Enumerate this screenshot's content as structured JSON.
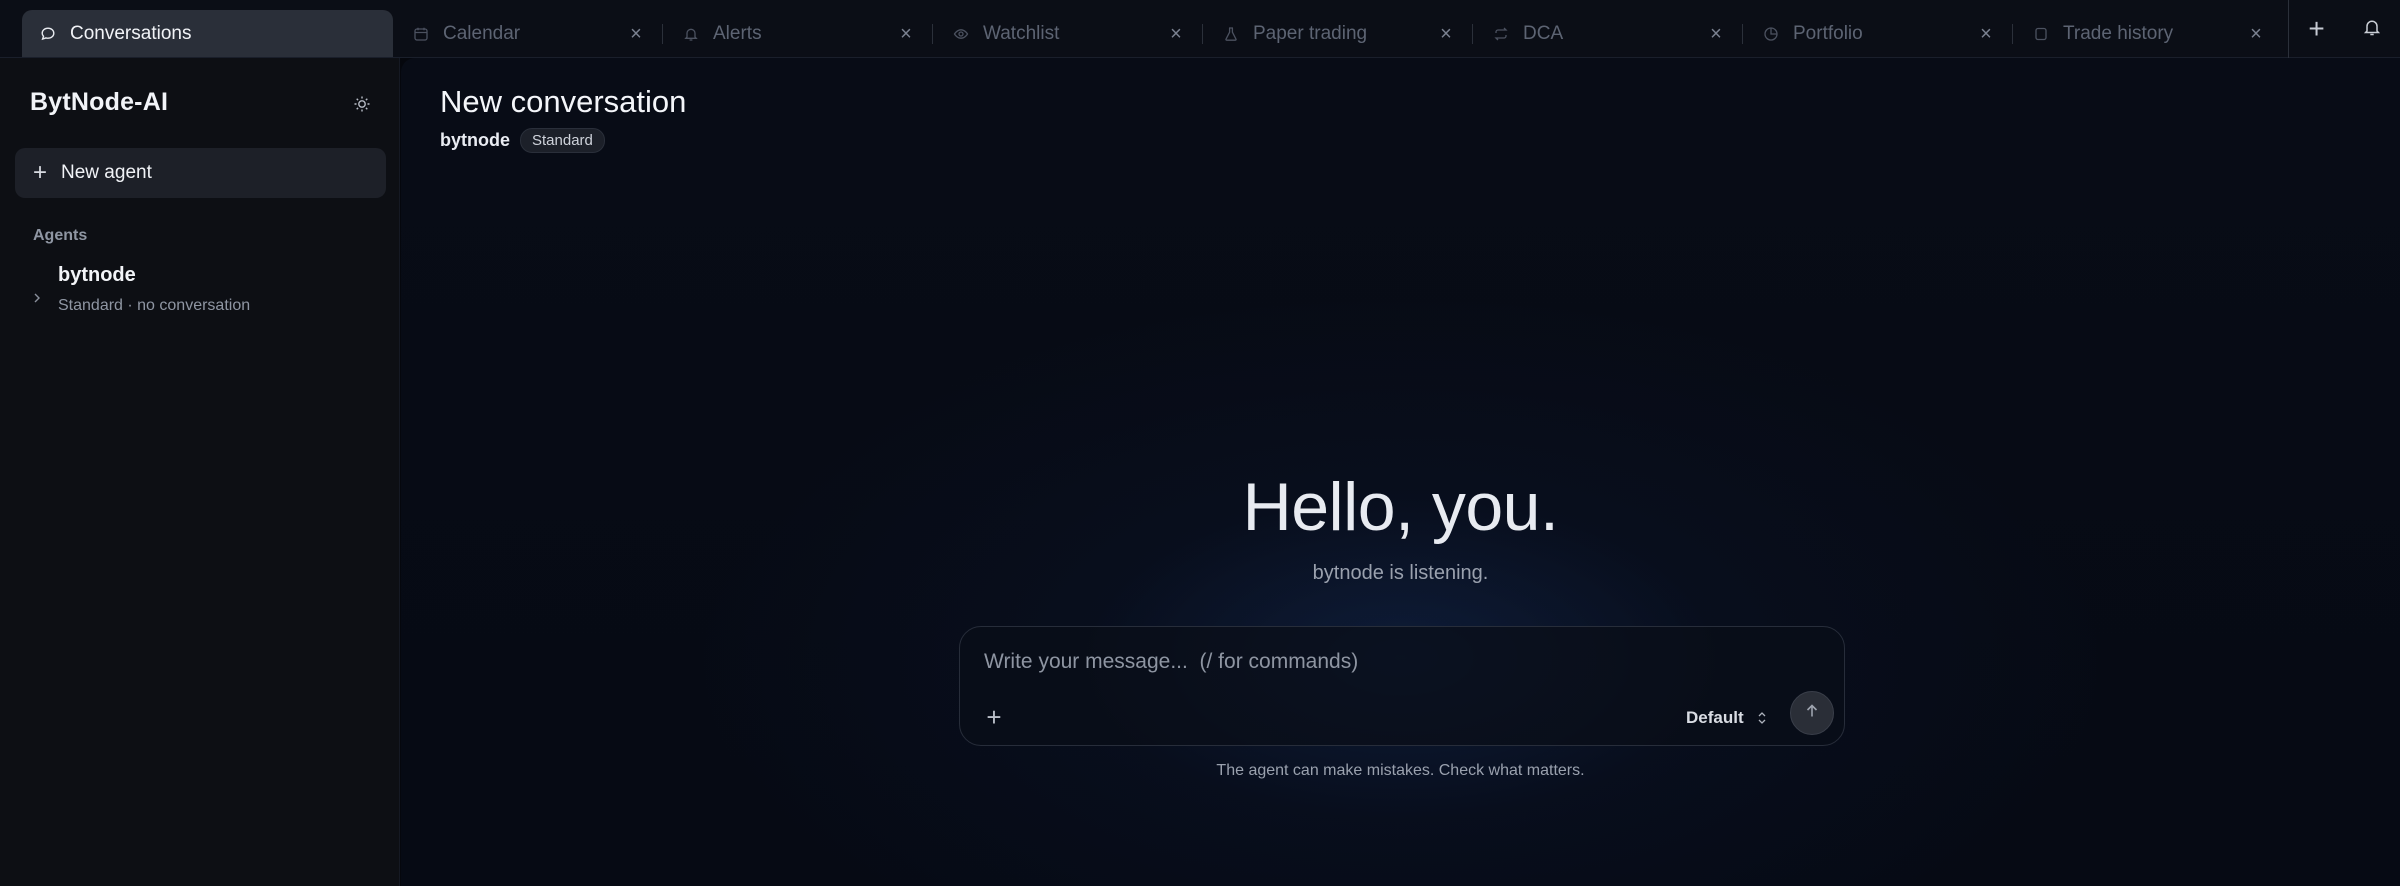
{
  "tabs": [
    {
      "label": "Conversations",
      "icon": "chat-bubble-icon",
      "active": true
    },
    {
      "label": "Calendar",
      "icon": "calendar-icon"
    },
    {
      "label": "Alerts",
      "icon": "bell-icon"
    },
    {
      "label": "Watchlist",
      "icon": "eye-icon"
    },
    {
      "label": "Paper trading",
      "icon": "flask-icon"
    },
    {
      "label": "DCA",
      "icon": "repeat-icon"
    },
    {
      "label": "Portfolio",
      "icon": "pie-chart-icon"
    },
    {
      "label": "Trade history",
      "icon": "receipt-icon"
    }
  ],
  "tab_close_glyph": "×",
  "tab_add_glyph": "+",
  "sidebar": {
    "brand": "BytNode-AI",
    "new_agent_label": "New agent",
    "new_agent_glyph": "+",
    "agents_heading": "Agents",
    "agents": [
      {
        "name": "bytnode",
        "meta": "Standard · no conversation"
      }
    ]
  },
  "main": {
    "title": "New conversation",
    "agent": "bytnode",
    "badge": "Standard",
    "hero_title": "Hello, you.",
    "hero_subtitle": "bytnode is listening.",
    "composer": {
      "placeholder": "Write your message...  (/ for commands)",
      "attach_glyph": "+",
      "mode": "Default"
    },
    "disclaimer": "The agent can make mistakes. Check what matters."
  },
  "colors": {
    "accent_active_tab": "#2a2f39",
    "sidebar_bg": "#0d0f14",
    "main_bg": "#070b15"
  }
}
